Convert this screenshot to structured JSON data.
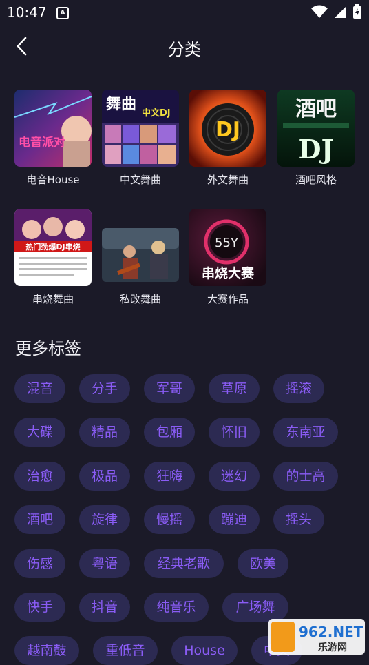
{
  "status": {
    "time": "10:47",
    "badge": "A"
  },
  "header": {
    "title": "分类"
  },
  "categories": [
    {
      "label": "电音House"
    },
    {
      "label": "中文舞曲"
    },
    {
      "label": "外文舞曲"
    },
    {
      "label": "酒吧风格"
    },
    {
      "label": "串烧舞曲"
    },
    {
      "label": "私改舞曲"
    },
    {
      "label": "大赛作品"
    }
  ],
  "thumb_text": {
    "t1": "电音派对",
    "t2a": "舞曲",
    "t2b": "中文DJ",
    "t3": "DJ",
    "t4a": "酒吧",
    "t4b": "DJ",
    "t5": "热门劲爆DJ串烧",
    "t7a": "55Y",
    "t7b": "串烧大赛"
  },
  "more_tags_title": "更多标签",
  "tags": [
    "混音",
    "分手",
    "军哥",
    "草原",
    "摇滚",
    "大碟",
    "精品",
    "包厢",
    "怀旧",
    "东南亚",
    "治愈",
    "极品",
    "狂嗨",
    "迷幻",
    "的士高",
    "酒吧",
    "旋律",
    "慢摇",
    "蹦迪",
    "摇头",
    "伤感",
    "粤语",
    "经典老歌",
    "欧美",
    "快手",
    "抖音",
    "纯音乐",
    "广场舞",
    "越南鼓",
    "重低音",
    "House",
    "中文"
  ],
  "watermark": {
    "brand": "962.NET",
    "sub": "乐游网"
  }
}
